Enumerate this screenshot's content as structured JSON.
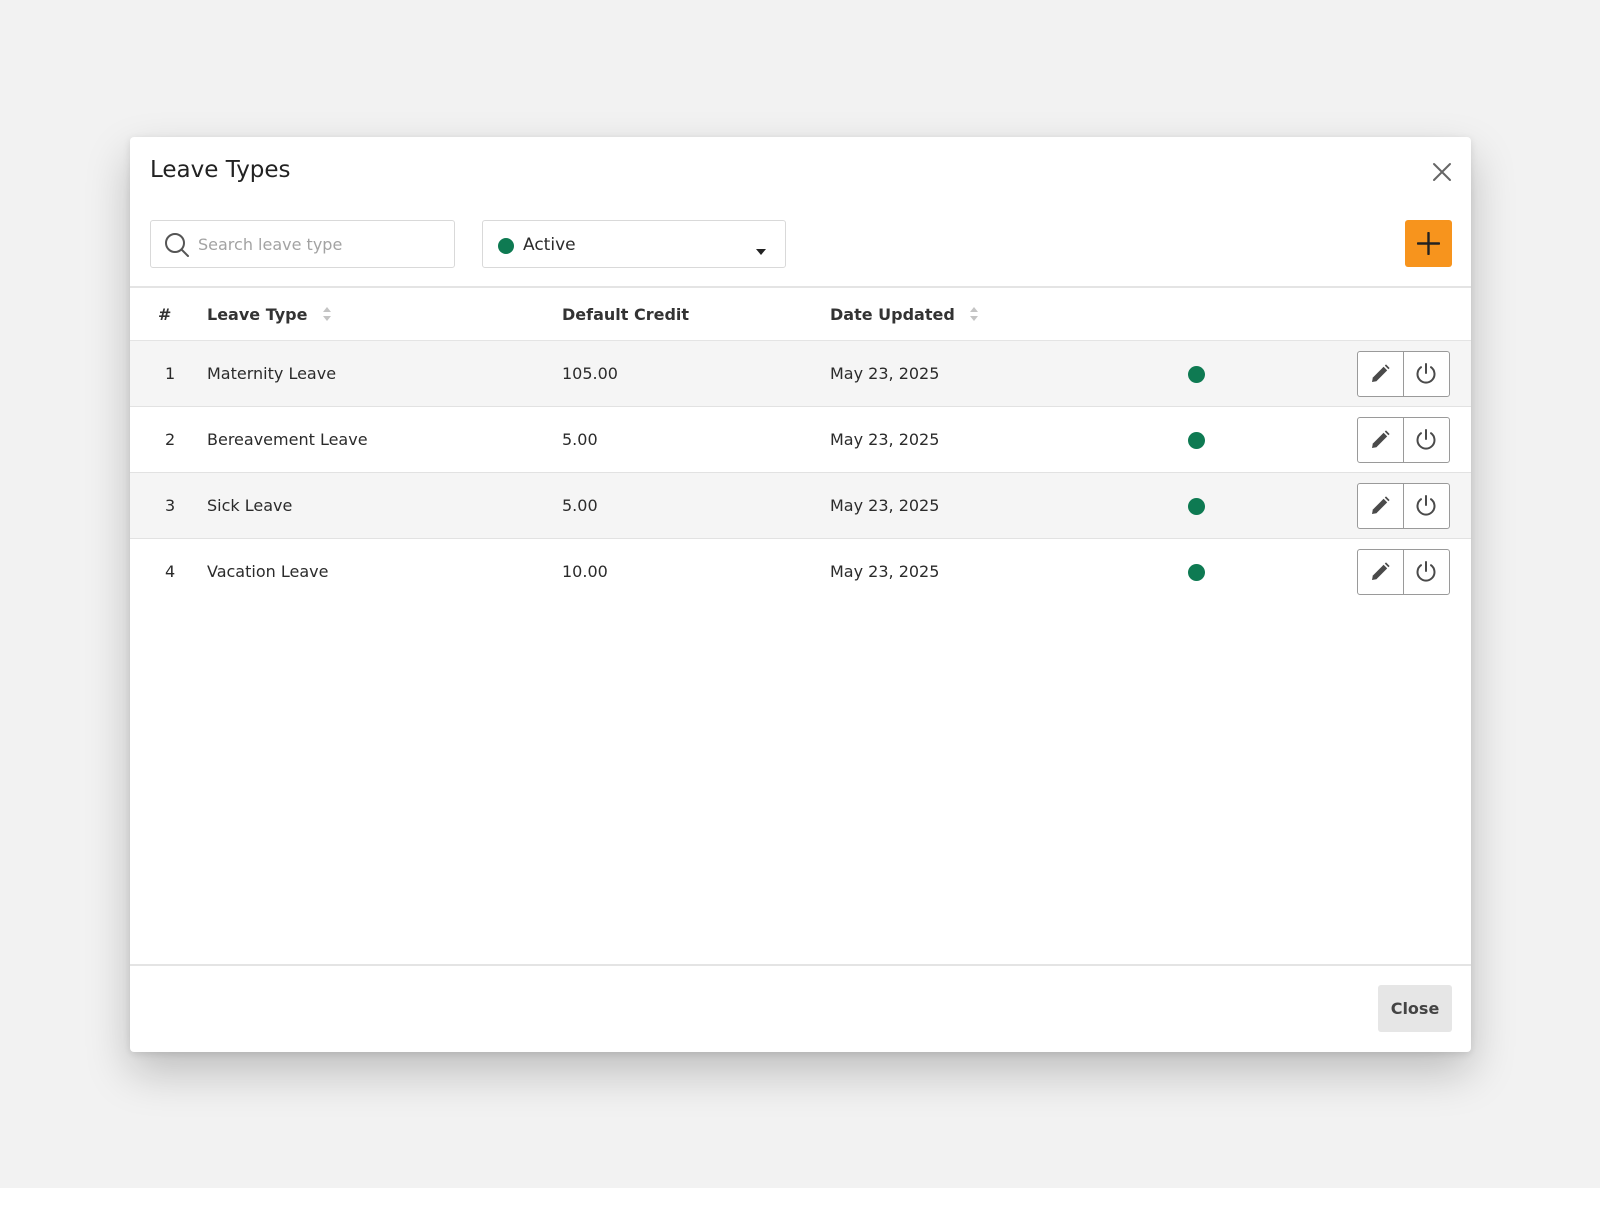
{
  "modal": {
    "title": "Leave Types"
  },
  "toolbar": {
    "search_placeholder": "Search leave type",
    "search_value": "",
    "status_filter": {
      "selected": "Active",
      "dot_color": "#0e7a52"
    },
    "add_icon": "plus-icon",
    "add_color": "#f7941d"
  },
  "table": {
    "headers": {
      "num": "#",
      "leave_type": "Leave Type",
      "default_credit": "Default Credit",
      "date_updated": "Date Updated"
    },
    "rows": [
      {
        "num": "1",
        "leave_type": "Maternity Leave",
        "default_credit": "105.00",
        "date_updated": "May 23, 2025",
        "status": "active"
      },
      {
        "num": "2",
        "leave_type": "Bereavement Leave",
        "default_credit": "5.00",
        "date_updated": "May 23, 2025",
        "status": "active"
      },
      {
        "num": "3",
        "leave_type": "Sick Leave",
        "default_credit": "5.00",
        "date_updated": "May 23, 2025",
        "status": "active"
      },
      {
        "num": "4",
        "leave_type": "Vacation Leave",
        "default_credit": "10.00",
        "date_updated": "May 23, 2025",
        "status": "active"
      }
    ],
    "row_action_icons": [
      "pencil-icon",
      "power-icon"
    ]
  },
  "footer": {
    "close_label": "Close"
  }
}
